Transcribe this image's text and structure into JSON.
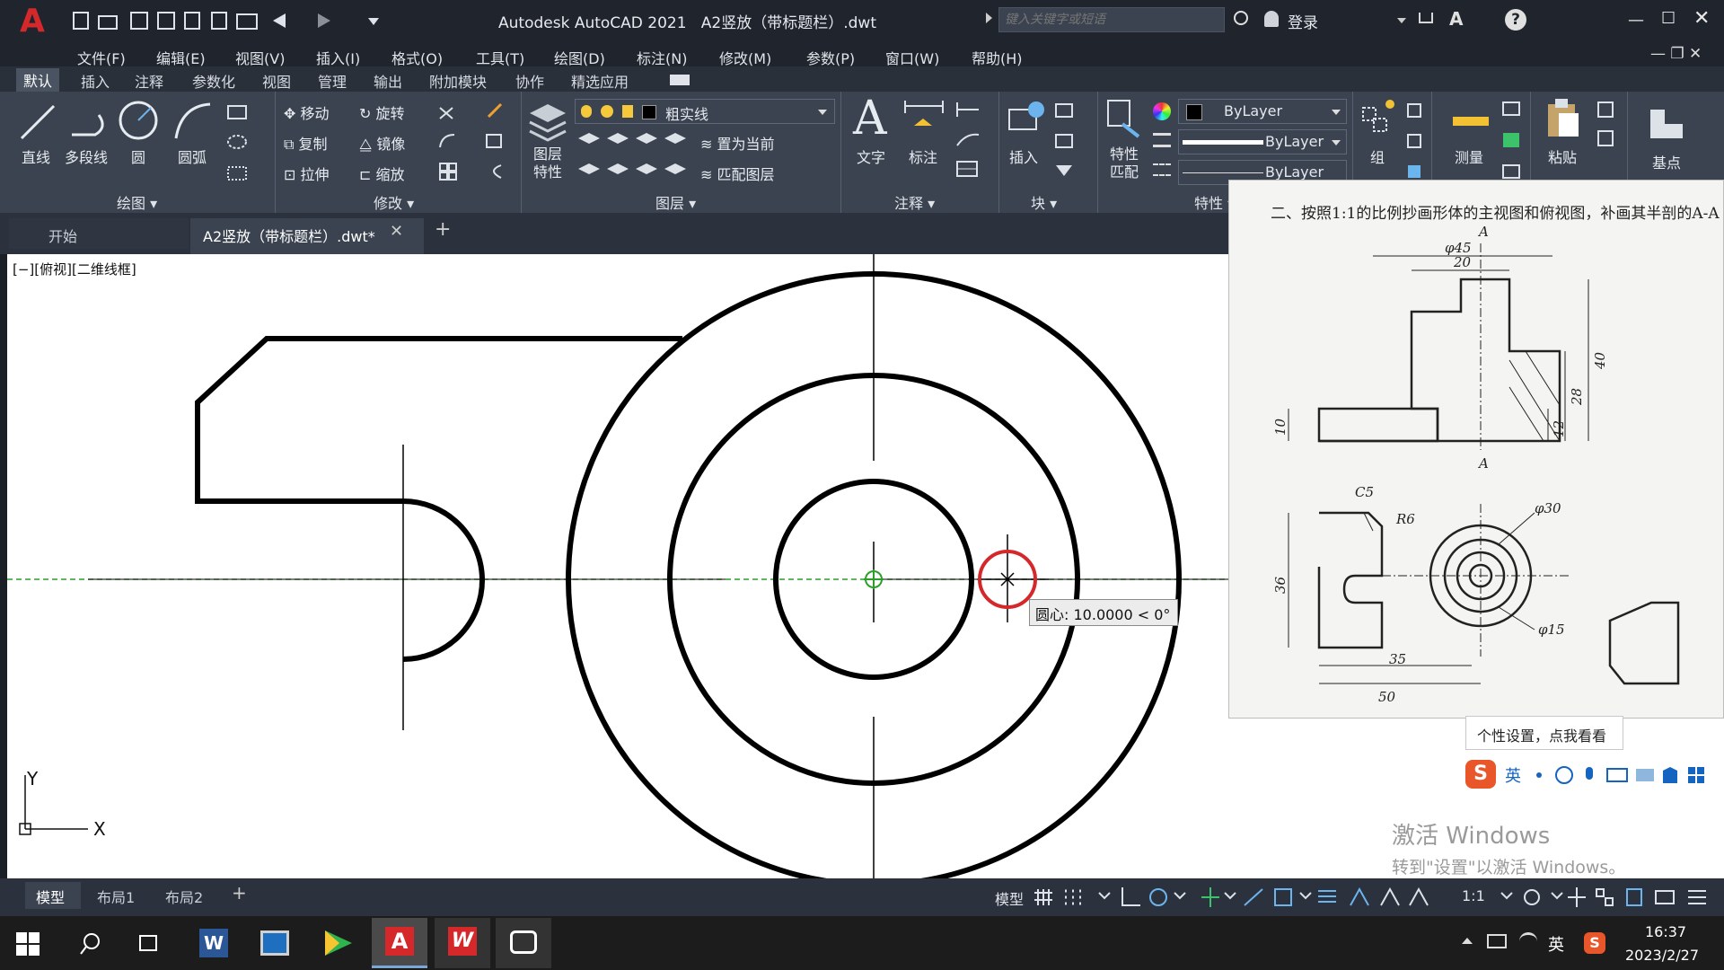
{
  "app": {
    "title": "Autodesk AutoCAD 2021",
    "document": "A2竖放（带标题栏）.dwt",
    "search_placeholder": "键入关键字或短语",
    "login": "登录",
    "logo": "A"
  },
  "menu": [
    "文件(F)",
    "编辑(E)",
    "视图(V)",
    "插入(I)",
    "格式(O)",
    "工具(T)",
    "绘图(D)",
    "标注(N)",
    "修改(M)",
    "参数(P)",
    "窗口(W)",
    "帮助(H)"
  ],
  "ribbon_tabs": [
    "默认",
    "插入",
    "注释",
    "参数化",
    "视图",
    "管理",
    "输出",
    "附加模块",
    "协作",
    "精选应用"
  ],
  "ribbon": {
    "draw": {
      "title": "绘图",
      "tools": [
        "直线",
        "多段线",
        "圆",
        "圆弧"
      ]
    },
    "modify": {
      "title": "修改",
      "tools": [
        "移动",
        "旋转",
        "复制",
        "镜像",
        "拉伸",
        "缩放"
      ]
    },
    "layers": {
      "title": "图层",
      "current_layer": "粗实线",
      "props_label": "图层\n特性",
      "set_current": "置为当前",
      "match_layer": "匹配图层"
    },
    "annotation": {
      "title": "注释",
      "text": "文字",
      "dim": "标注"
    },
    "block": {
      "title": "块",
      "insert": "插入"
    },
    "properties": {
      "title": "特性",
      "match": "特性\n匹配",
      "color": "ByLayer",
      "linetype": "ByLayer",
      "lineweight": "ByLayer"
    },
    "group": "组",
    "measure": "测量",
    "paste": "粘贴",
    "basepoint": "基点"
  },
  "doc_tabs": {
    "start": "开始",
    "active": "A2竖放（带标题栏）.dwt*"
  },
  "viewport_label": "[−][俯视][二维线框]",
  "tooltip": {
    "label": "圆心:",
    "value": "10.0000 < 0°"
  },
  "ucs": {
    "x": "X",
    "y": "Y"
  },
  "layout_tabs": [
    "模型",
    "布局1",
    "布局2"
  ],
  "status": {
    "model": "模型",
    "scale": "1:1"
  },
  "reference": {
    "title": "二、按照1:1的比例抄画形体的主视图和俯视图，补画其半剖的A-A",
    "dims": {
      "phi45": "φ45",
      "d20": "20",
      "d40": "40",
      "d28": "28",
      "d12": "12",
      "d10": "10",
      "A_top": "A",
      "A_bottom": "A",
      "c5": "C5",
      "r6": "R6",
      "phi30": "φ30",
      "phi15": "φ15",
      "d36": "36",
      "d35": "35",
      "d50": "50"
    }
  },
  "ime": {
    "tip": "个性设置，点我看看",
    "lang": "英"
  },
  "activation": {
    "line1": "激活 Windows",
    "line2": "转到\"设置\"以激活 Windows。"
  },
  "taskbar": {
    "time": "16:37",
    "date": "2023/2/27",
    "lang": "英"
  },
  "colors": {
    "accent_red": "#d4282b",
    "title_bg": "#20252d",
    "ribbon_bg": "#3b4350",
    "center_line": "#2c9e2c"
  }
}
